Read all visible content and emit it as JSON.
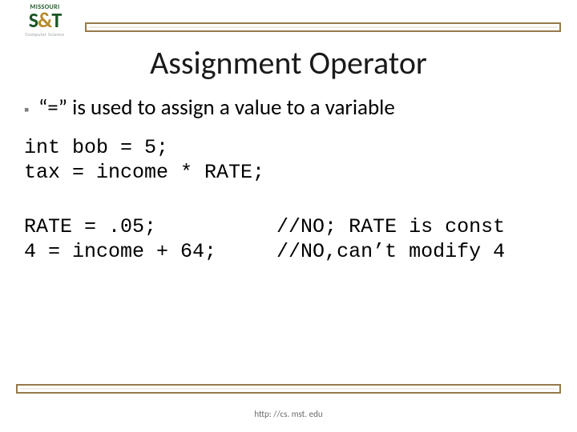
{
  "logo": {
    "top": "MISSOURI",
    "mid_s": "S",
    "mid_amp": "&",
    "mid_t": "T",
    "sub": "Computer Science"
  },
  "title": "Assignment Operator",
  "bullets": [
    {
      "marker": "▪",
      "text": "“=” is used to assign a value to a variable"
    }
  ],
  "code1": "int bob = 5;\ntax = income * RATE;",
  "code2": "RATE = .05;          //NO; RATE is const\n4 = income + 64;     //NO,can’t modify 4",
  "footer": "http: //cs. mst. edu"
}
